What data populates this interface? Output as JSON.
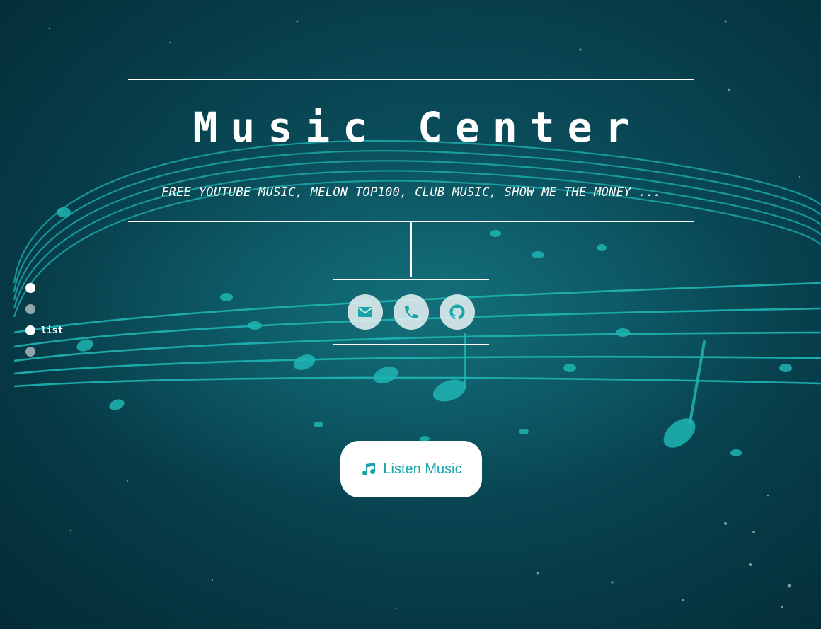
{
  "page": {
    "title": "Music Center",
    "subtitle": "FREE YOUTUBE MUSIC, MELON TOP100, CLUB MUSIC, SHOW ME THE MONEY ..."
  },
  "contact_icons": [
    {
      "icon": "envelope-icon"
    },
    {
      "icon": "phone-icon"
    },
    {
      "icon": "github-icon"
    }
  ],
  "cta": {
    "label": "Listen Music",
    "icon": "music-note-icon"
  },
  "side_nav": {
    "items": [
      {
        "label": "",
        "active": true
      },
      {
        "label": "",
        "active": false
      },
      {
        "label": "list",
        "active": true
      },
      {
        "label": "",
        "active": false
      }
    ]
  },
  "colors": {
    "background": "#0a4a58",
    "accent": "#1aa3a8",
    "text": "#ffffff",
    "icon_bg": "#e1eef0"
  }
}
